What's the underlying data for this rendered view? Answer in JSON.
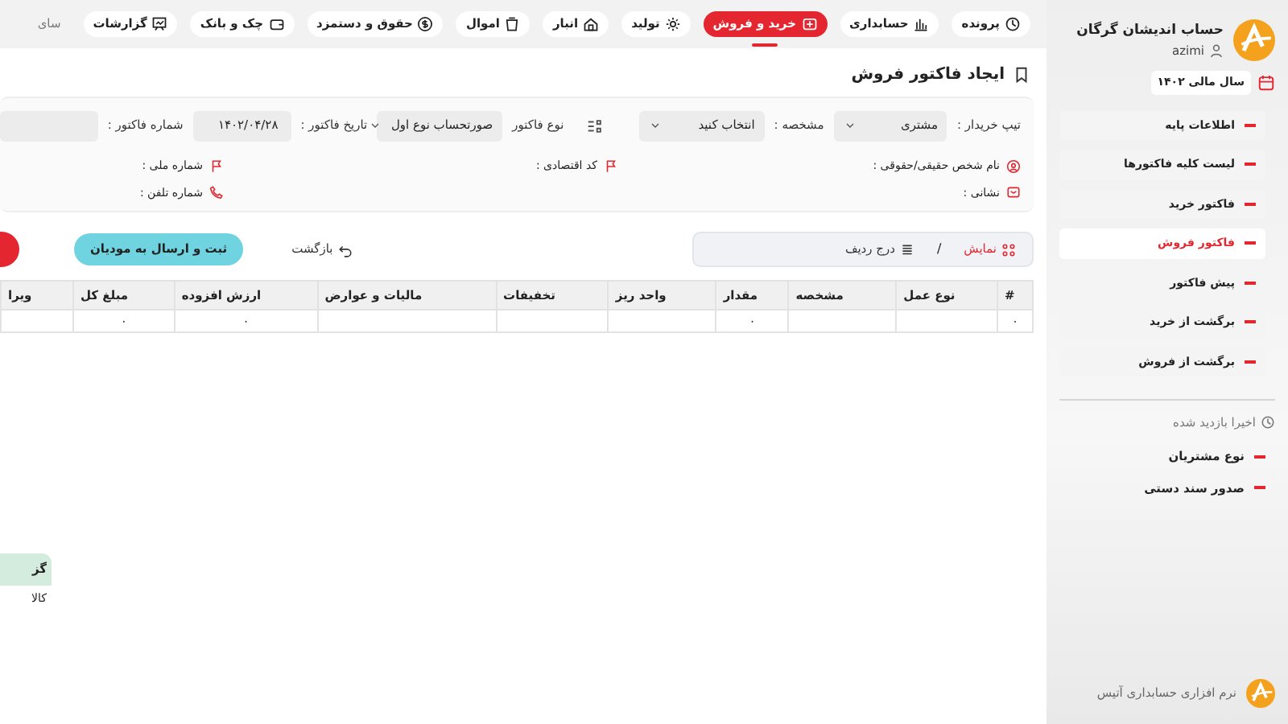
{
  "top_nav": [
    {
      "label": "پرونده",
      "selected": false
    },
    {
      "label": "حسابداری",
      "selected": false
    },
    {
      "label": "خرید و فروش",
      "selected": true
    },
    {
      "label": "تولید",
      "selected": false
    },
    {
      "label": "انبار",
      "selected": false
    },
    {
      "label": "اموال",
      "selected": false
    },
    {
      "label": "حقوق و دستمزد",
      "selected": false
    },
    {
      "label": "چک و بانک",
      "selected": false
    },
    {
      "label": "گزارشات",
      "selected": false
    },
    {
      "label": "سای",
      "selected": false
    }
  ],
  "page_title": "ایجاد فاکتور فروش",
  "form": {
    "fields": [
      {
        "label": "تیپ خریدار :",
        "kind": "select",
        "value": "مشتری"
      },
      {
        "label": "مشخصه :",
        "kind": "select",
        "value": "انتخاب کنید"
      },
      {
        "kind": "grid"
      },
      {
        "label": "نوع فاکتور",
        "kind": "select",
        "value": "صورتحساب نوع اول"
      },
      {
        "label": "تاریخ فاکتور :",
        "kind": "input",
        "value": "۱۴۰۲/۰۴/۲۸"
      },
      {
        "label": "شماره فاکتور :",
        "kind": "input"
      }
    ],
    "info_rows": [
      [
        {
          "label": "نام شخص حقیقی/حقوقی :"
        },
        {
          "label": "کد اقتصادی :"
        },
        {
          "label": "شماره ملی :"
        }
      ],
      [
        {
          "label": "نشانی :"
        },
        {
          "label": "شماره تلفن :"
        }
      ]
    ]
  },
  "toolbar": {
    "view": {
      "label": "نمایش",
      "selected": true
    },
    "separator": "/",
    "insert": {
      "label": "درج ردیف",
      "selected": false
    },
    "back": "بازگشت",
    "submit": "ثبت و ارسال به مودیان"
  },
  "table": {
    "columns": [
      "#",
      "نوع عمل",
      "مشخصه",
      "مقدار",
      "واحد ریز",
      "تخفیفات",
      "مالیات و عوارض",
      "ارزش افزوده",
      "مبلغ کل",
      "ویرا"
    ],
    "rows": [
      [
        "۰",
        null,
        null,
        "۰",
        null,
        null,
        null,
        "۰",
        "۰",
        null
      ]
    ]
  },
  "bottom_panel": {
    "title": "گز",
    "rows": [
      "کالا"
    ]
  },
  "sidebar": {
    "company": "حساب اندیشان گرگان",
    "user": "azimi",
    "fiscal_year": "سال مالی ۱۴۰۲",
    "menu": [
      {
        "label": "اطلاعات پایه",
        "selected": false
      },
      {
        "label": "لیست کلیه فاکتورها",
        "selected": false
      },
      {
        "label": "فاکتور خرید",
        "selected": false
      },
      {
        "label": "فاکتور فروش",
        "selected": true
      },
      {
        "label": "پیش فاکتور",
        "selected": false
      },
      {
        "label": "برگشت از خرید",
        "selected": false
      },
      {
        "label": "برگشت از فروش",
        "selected": false
      }
    ],
    "recent_title": "اخیرا بازدید شده",
    "recent": [
      "نوع مشتریان",
      "صدور سند دستی"
    ],
    "footer": "نرم افزاری حسابداری آتیس"
  }
}
